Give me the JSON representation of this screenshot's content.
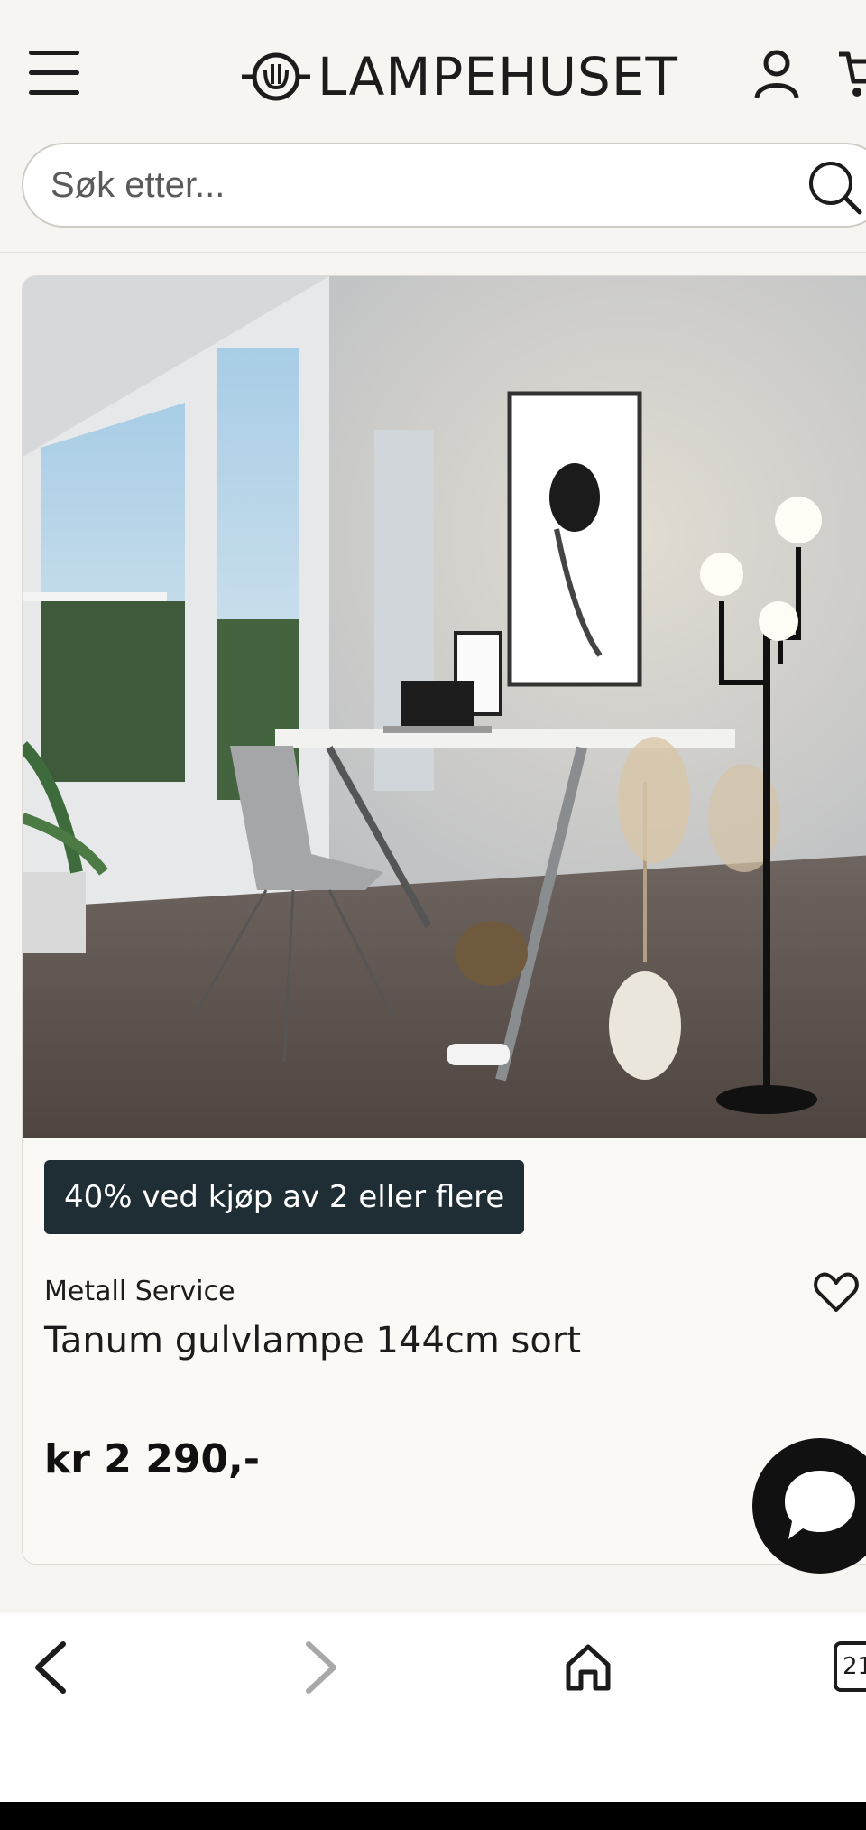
{
  "header": {
    "menu_icon": "hamburger-menu-icon",
    "logo_text": "LAMPEHUSET",
    "account_icon": "user-icon",
    "cart_icon": "cart-icon"
  },
  "search": {
    "placeholder": "Søk etter...",
    "value": "",
    "icon": "search-icon"
  },
  "product": {
    "promo_badge": "40% ved kjøp av 2 eller flere",
    "brand": "Metall Service",
    "title": "Tanum gulvlampe 144cm sort",
    "price": "kr 2 290,-",
    "favorite_icon": "heart-icon"
  },
  "chat": {
    "icon": "chat-bubble-icon"
  },
  "browser_nav": {
    "back_icon": "chevron-left-icon",
    "forward_icon": "chevron-right-icon",
    "home_icon": "home-icon",
    "tab_count": "21"
  },
  "colors": {
    "page_bg": "#f7f5f1",
    "badge_bg": "#1f2d35",
    "text": "#1c1c1c"
  }
}
